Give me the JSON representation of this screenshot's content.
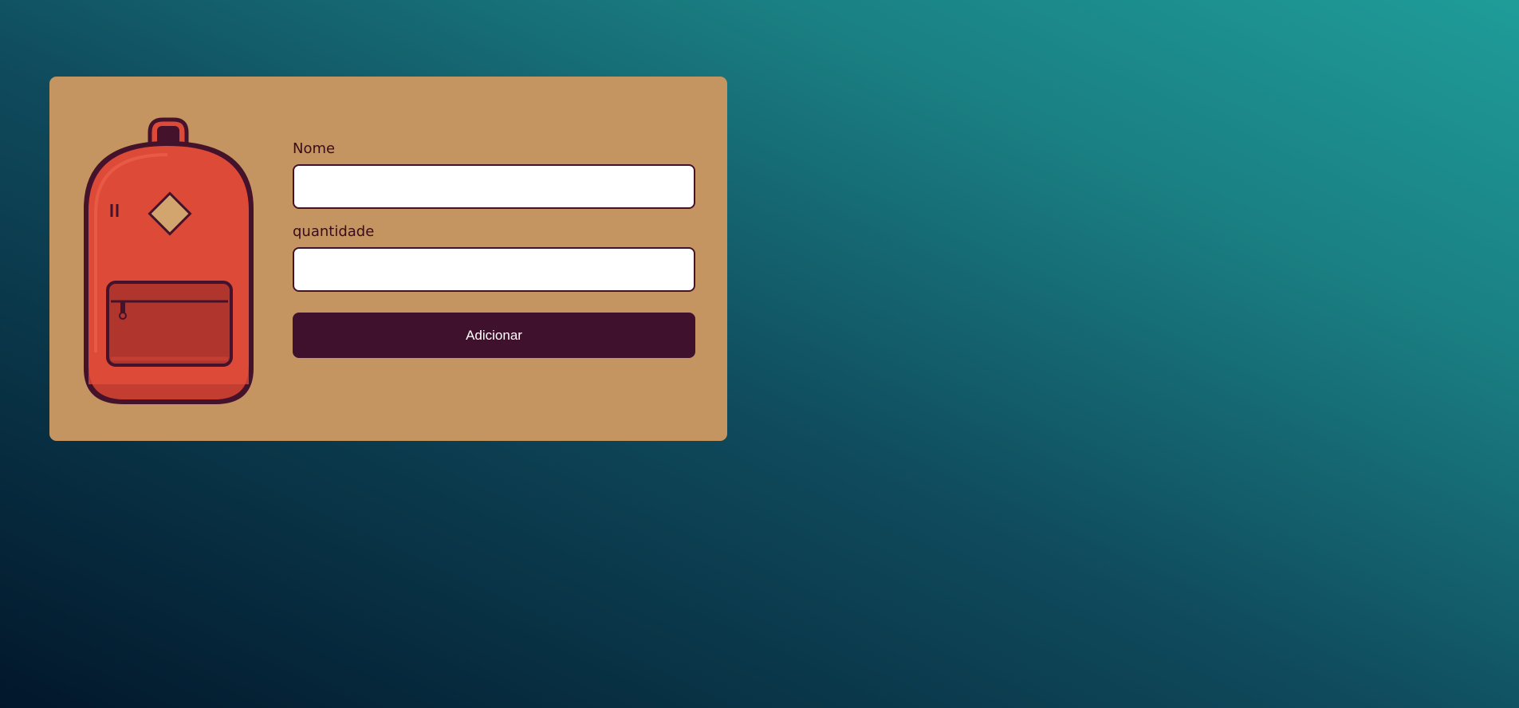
{
  "form": {
    "name_label": "Nome",
    "name_value": "",
    "quantity_label": "quantidade",
    "quantity_value": "",
    "submit_label": "Adicionar"
  },
  "illustration": {
    "icon": "backpack-icon",
    "colors": {
      "card_background": "#c49561",
      "backpack_body": "#dd4a38",
      "pocket": "#b0362d",
      "outline": "#44122a",
      "patch": "#d2a56f",
      "button": "#40112c"
    }
  }
}
